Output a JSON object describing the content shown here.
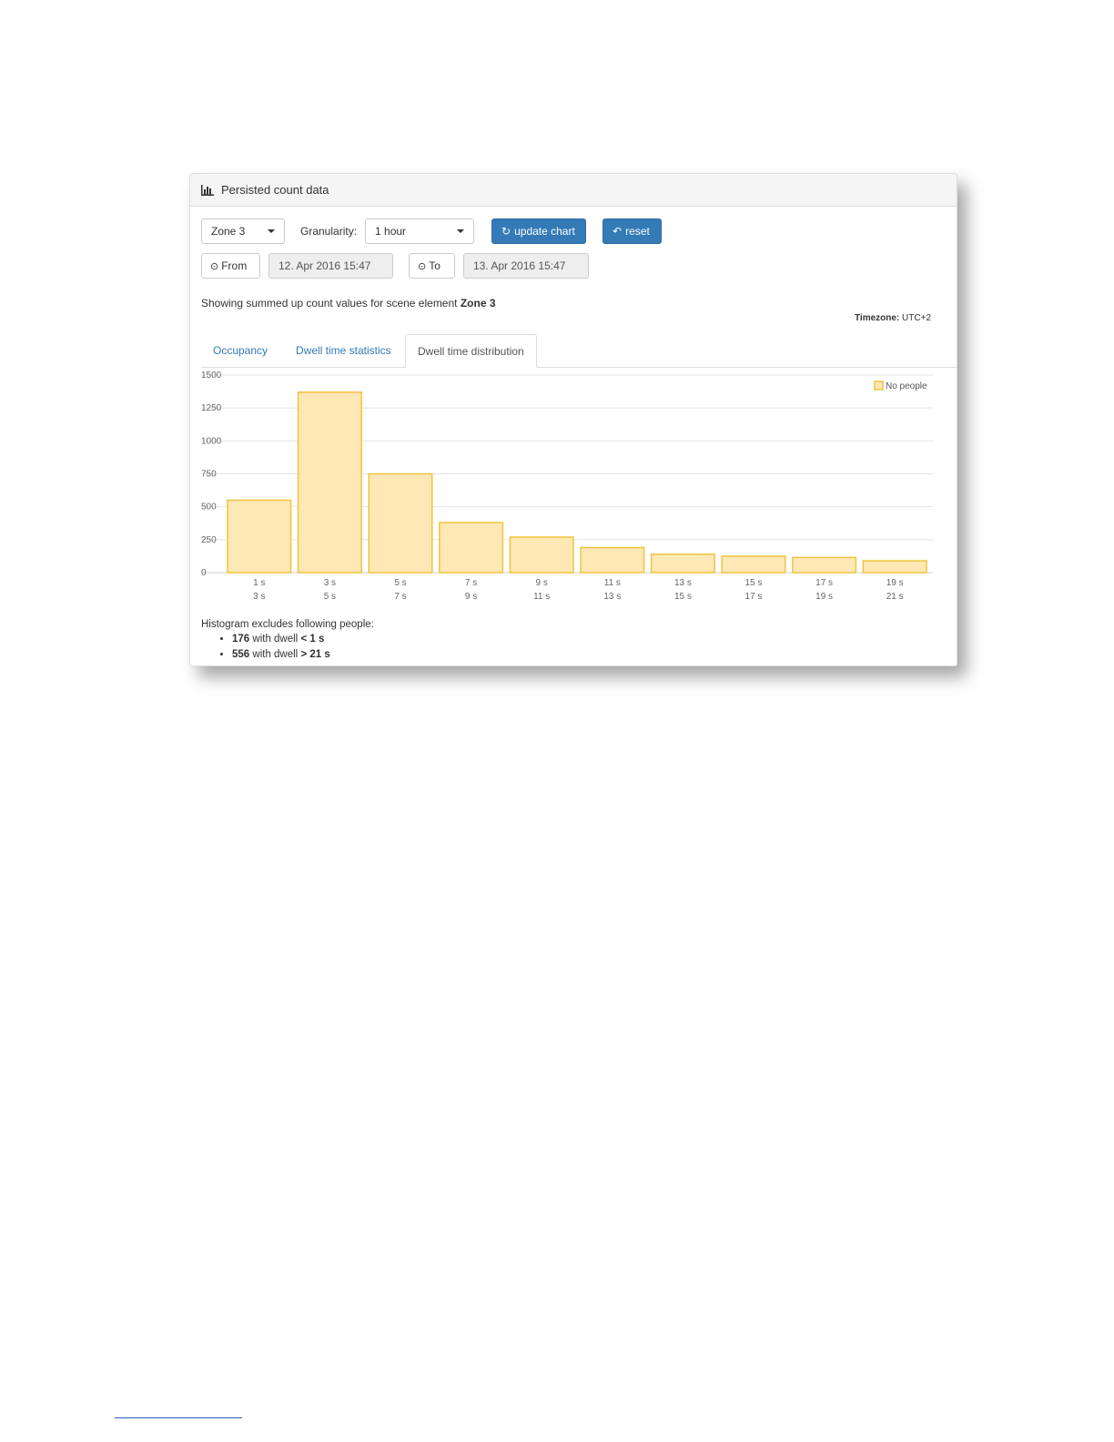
{
  "panel": {
    "title": "Persisted count data"
  },
  "controls": {
    "zone_value": "Zone 3",
    "granularity_label": "Granularity:",
    "granularity_value": "1 hour",
    "update_label": "update chart",
    "reset_label": "reset",
    "from_label": "From",
    "from_value": "12. Apr 2016 15:47",
    "to_label": "To",
    "to_value": "13. Apr 2016 15:47"
  },
  "summary": {
    "text": "Showing summed up count values for scene element ",
    "element": "Zone 3"
  },
  "timezone": {
    "label": "Timezone:",
    "value": "UTC+2"
  },
  "tabs": [
    {
      "label": "Occupancy",
      "active": false
    },
    {
      "label": "Dwell time statistics",
      "active": false
    },
    {
      "label": "Dwell time distribution",
      "active": true
    }
  ],
  "notes": {
    "intro": "Histogram excludes following people:",
    "items": [
      {
        "count": "176",
        "text": " with dwell ",
        "cond": "< 1 s"
      },
      {
        "count": "556",
        "text": " with dwell ",
        "cond": "> 21 s"
      }
    ]
  },
  "colors": {
    "bar_fill": "#fde8b6",
    "bar_stroke": "#f1c43f",
    "primary": "#337ab7"
  },
  "chart_data": {
    "type": "bar",
    "categories": [
      [
        "1 s",
        "3 s"
      ],
      [
        "3 s",
        "5 s"
      ],
      [
        "5 s",
        "7 s"
      ],
      [
        "7 s",
        "9 s"
      ],
      [
        "9 s",
        "11 s"
      ],
      [
        "11 s",
        "13 s"
      ],
      [
        "13 s",
        "15 s"
      ],
      [
        "15 s",
        "17 s"
      ],
      [
        "17 s",
        "19 s"
      ],
      [
        "19 s",
        "21 s"
      ]
    ],
    "series": [
      {
        "name": "No people",
        "values": [
          550,
          1370,
          750,
          380,
          270,
          190,
          140,
          125,
          115,
          90
        ]
      }
    ],
    "yticks": [
      0,
      250,
      500,
      750,
      1000,
      1250,
      1500
    ],
    "ylim": [
      0,
      1500
    ],
    "grid": true,
    "legend": "top-right"
  }
}
